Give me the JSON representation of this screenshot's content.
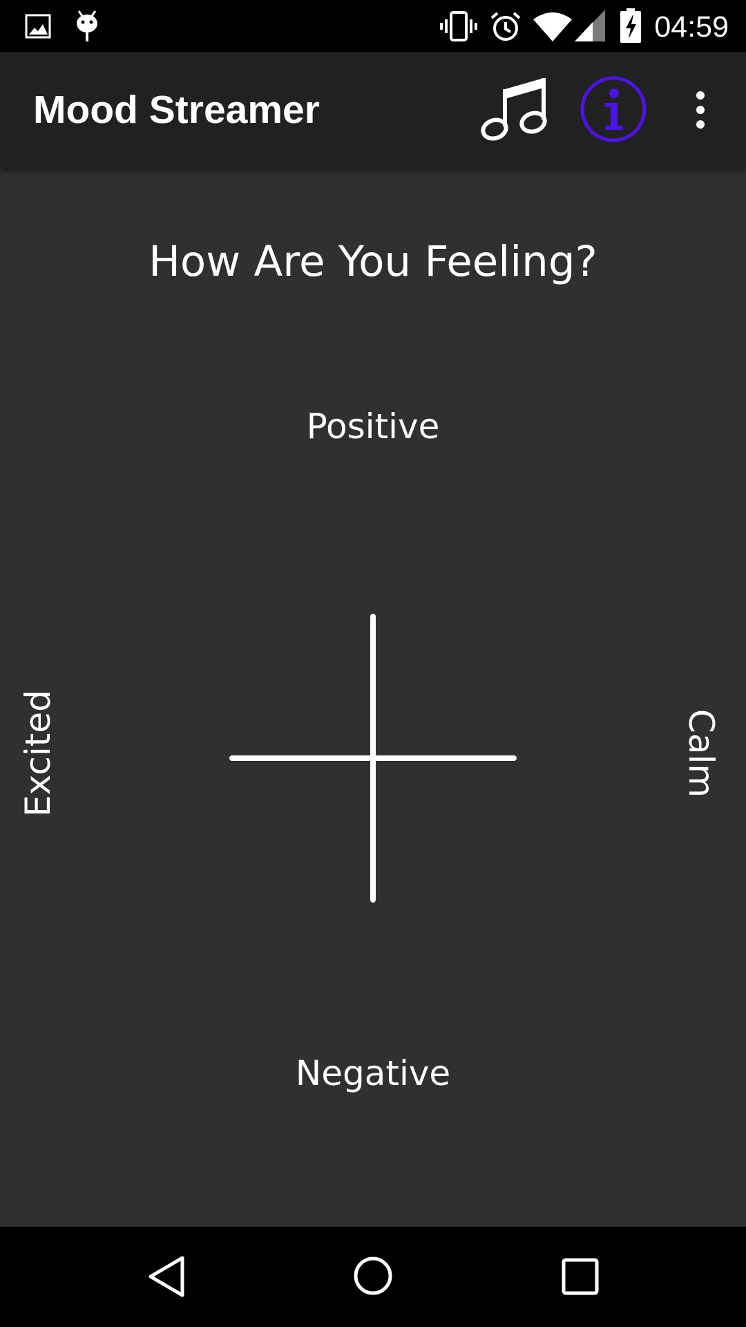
{
  "status_bar": {
    "time": "04:59",
    "left_icons": [
      "image-notification-icon",
      "android-debug-icon"
    ],
    "right_icons": [
      "vibrate-icon",
      "alarm-icon",
      "wifi-icon",
      "cell-signal-icon",
      "battery-charging-icon"
    ]
  },
  "app_bar": {
    "title": "Mood Streamer",
    "actions": [
      "music-note-icon",
      "info-icon",
      "overflow-menu-icon"
    ],
    "info_icon_color": "#4a14e8"
  },
  "main": {
    "question": "How Are You Feeling?",
    "axis_labels": {
      "top": "Positive",
      "bottom": "Negative",
      "left": "Excited",
      "right": "Calm"
    }
  },
  "nav_bar": {
    "buttons": [
      "back-icon",
      "home-icon",
      "recents-icon"
    ]
  },
  "colors": {
    "status_bar": "#000000",
    "app_bar": "#212121",
    "background": "#303030",
    "text": "#ffffff",
    "accent": "#4a14e8"
  }
}
